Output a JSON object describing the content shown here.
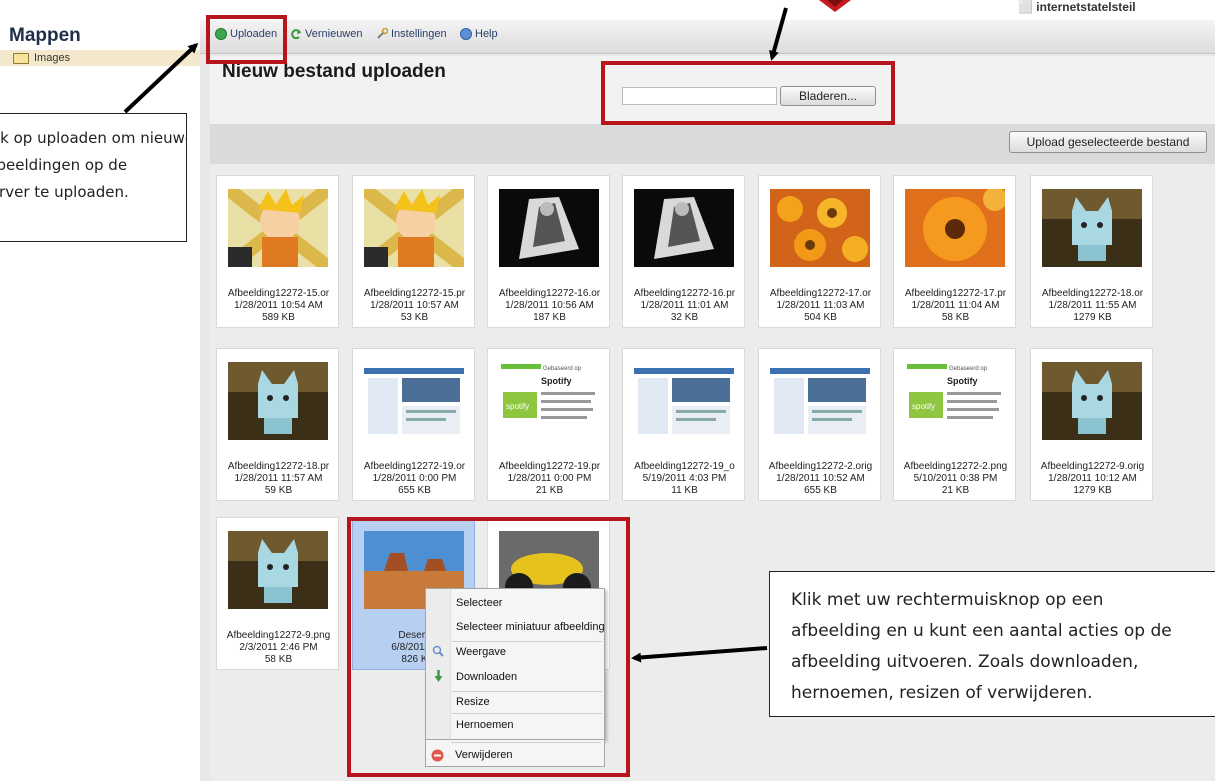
{
  "sidebar": {
    "title": "Mappen",
    "folders": [
      {
        "label": "Images"
      }
    ]
  },
  "toolbar": {
    "items": [
      {
        "label": "Uploaden",
        "icon": "upload-icon"
      },
      {
        "label": "Vernieuwen",
        "icon": "refresh-icon"
      },
      {
        "label": "Instellingen",
        "icon": "settings-icon"
      },
      {
        "label": "Help",
        "icon": "help-icon"
      }
    ]
  },
  "upload": {
    "title": "Nieuw bestand uploaden",
    "browse_label": "Bladeren...",
    "file_value": "",
    "upload_selected_label": "Upload geselecteerde bestand"
  },
  "header_top_text": "⬜ internetstatelsteil",
  "files": [
    {
      "name": "Afbeelding12272-15.or",
      "date": "1/28/2011 10:54 AM",
      "size": "589 KB",
      "thumb": "anime"
    },
    {
      "name": "Afbeelding12272-15.pr",
      "date": "1/28/2011 10:57 AM",
      "size": "53 KB",
      "thumb": "anime"
    },
    {
      "name": "Afbeelding12272-16.or",
      "date": "1/28/2011 10:56 AM",
      "size": "187 KB",
      "thumb": "dark"
    },
    {
      "name": "Afbeelding12272-16.pr",
      "date": "1/28/2011 11:01 AM",
      "size": "32 KB",
      "thumb": "dark"
    },
    {
      "name": "Afbeelding12272-17.or",
      "date": "1/28/2011 11:03 AM",
      "size": "504 KB",
      "thumb": "flowers"
    },
    {
      "name": "Afbeelding12272-17.pr",
      "date": "1/28/2011 11:04 AM",
      "size": "58 KB",
      "thumb": "flower"
    },
    {
      "name": "Afbeelding12272-18.or",
      "date": "1/28/2011 11:55 AM",
      "size": "1279 KB",
      "thumb": "cat"
    },
    {
      "name": "Afbeelding12272-18.pr",
      "date": "1/28/2011 11:57 AM",
      "size": "59 KB",
      "thumb": "cat"
    },
    {
      "name": "Afbeelding12272-19.or",
      "date": "1/28/2011 0:00 PM",
      "size": "655 KB",
      "thumb": "screen"
    },
    {
      "name": "Afbeelding12272-19.pr",
      "date": "1/28/2011 0:00 PM",
      "size": "21 KB",
      "thumb": "spotify"
    },
    {
      "name": "Afbeelding12272-19_o",
      "date": "5/19/2011 4:03 PM",
      "size": "11 KB",
      "thumb": "screen"
    },
    {
      "name": "Afbeelding12272-2.orig",
      "date": "1/28/2011 10:52 AM",
      "size": "655 KB",
      "thumb": "screen"
    },
    {
      "name": "Afbeelding12272-2.png",
      "date": "5/10/2011 0:38 PM",
      "size": "21 KB",
      "thumb": "spotify"
    },
    {
      "name": "Afbeelding12272-9.orig",
      "date": "1/28/2011 10:12 AM",
      "size": "1279 KB",
      "thumb": "cat"
    },
    {
      "name": "Afbeelding12272-9.png",
      "date": "2/3/2011 2:46 PM",
      "size": "58 KB",
      "thumb": "cat"
    },
    {
      "name": "Desert.",
      "date": "6/8/2011 1",
      "size": "826 K",
      "thumb": "desert"
    },
    {
      "name": "",
      "date": "",
      "size": "",
      "thumb": "bike"
    }
  ],
  "context_menu": {
    "items": [
      {
        "label": "Selecteer",
        "icon": ""
      },
      {
        "label": "Selecteer miniatuur afbeelding",
        "icon": ""
      },
      {
        "label": "Weergave",
        "icon": "view-icon"
      },
      {
        "label": "Downloaden",
        "icon": "download-icon"
      },
      {
        "label": "Resize",
        "icon": ""
      },
      {
        "label": "Hernoemen",
        "icon": ""
      },
      {
        "label": "Verwijderen",
        "icon": "delete-icon"
      }
    ]
  },
  "callouts": {
    "left_lines": [
      "Klik op uploaden om nieuwe",
      "afbeeldingen op de",
      "server te uploaden."
    ],
    "right_lines": [
      "Klik met uw rechtermuisknop op een",
      "afbeelding en u kunt een aantal acties op de",
      "afbeelding uitvoeren. Zoals downloaden,",
      "hernoemen, resizen of verwijderen."
    ]
  },
  "colors": {
    "highlight": "#b8141b",
    "selected_tile": "#b7d0f1",
    "toolbar_text": "#2a3e6a"
  }
}
